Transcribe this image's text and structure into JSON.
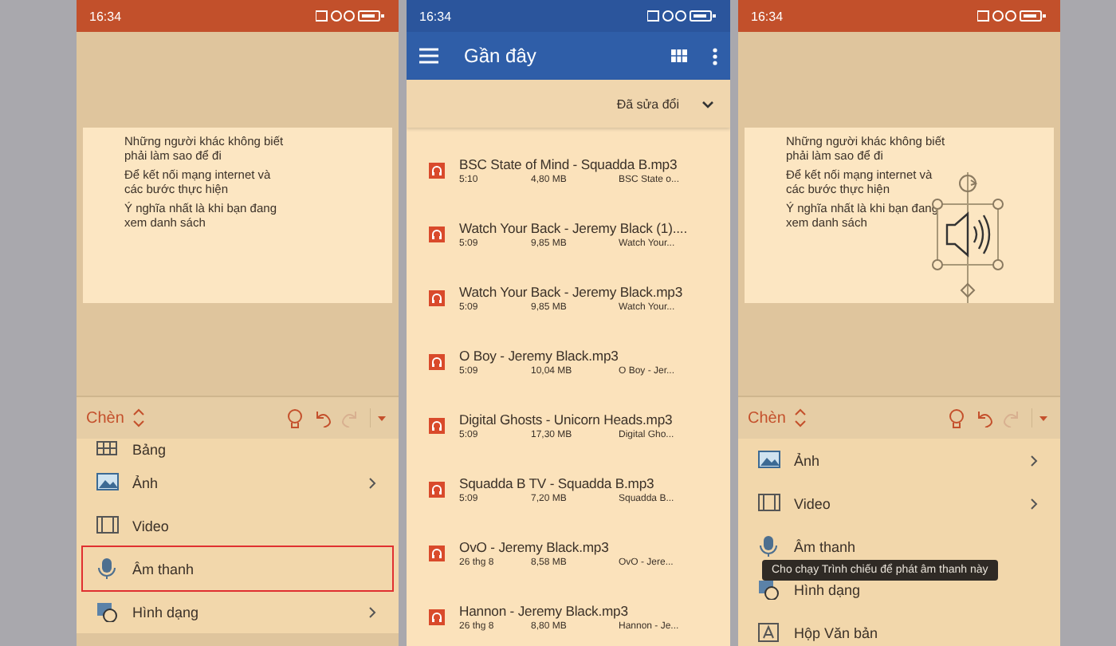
{
  "screens": [
    {
      "kind": "editor",
      "status_bar": {
        "time": "16:34"
      },
      "slide": {
        "lines": [
          "Những người khác không biết phải làm sao để đi",
          "Để kết nối mạng internet và các bước thực hiện",
          "Ý nghĩa nhất là khi bạn đang xem danh sách"
        ],
        "audio_object": false
      },
      "toolbar": {
        "tab": "Chèn",
        "redo_disabled": true
      },
      "menu": [
        {
          "label": "Bảng",
          "kind": "table",
          "submenu": false,
          "selected": false
        },
        {
          "label": "Ảnh",
          "kind": "image",
          "submenu": true,
          "selected": false
        },
        {
          "label": "Video",
          "kind": "film",
          "submenu": false,
          "selected": false
        },
        {
          "label": "Âm thanh",
          "kind": "mic",
          "submenu": false,
          "selected": true
        },
        {
          "label": "Hình dạng",
          "kind": "shape",
          "submenu": true,
          "selected": false
        }
      ]
    },
    {
      "kind": "files",
      "status_bar": {
        "time": "16:34"
      },
      "title": "Gần đây",
      "sort": "Đã sửa đổi",
      "files": [
        {
          "name": "BSC State of Mind - Squadda B.mp3",
          "date": "5:10",
          "size": "4,80 MB",
          "location": "BSC State o..."
        },
        {
          "name": "Watch Your Back - Jeremy Black (1)....",
          "date": "5:09",
          "size": "9,85 MB",
          "location": "Watch Your..."
        },
        {
          "name": "Watch Your Back - Jeremy Black.mp3",
          "date": "5:09",
          "size": "9,85 MB",
          "location": "Watch Your..."
        },
        {
          "name": "O Boy - Jeremy Black.mp3",
          "date": "5:09",
          "size": "10,04 MB",
          "location": "O Boy - Jer..."
        },
        {
          "name": "Digital Ghosts - Unicorn Heads.mp3",
          "date": "5:09",
          "size": "17,30 MB",
          "location": "Digital Gho..."
        },
        {
          "name": "Squadda B TV - Squadda B.mp3",
          "date": "5:09",
          "size": "7,20 MB",
          "location": "Squadda B..."
        },
        {
          "name": "OvO - Jeremy Black.mp3",
          "date": "26 thg 8",
          "size": "8,58 MB",
          "location": "OvO - Jere..."
        },
        {
          "name": "Hannon - Jeremy Black.mp3",
          "date": "26 thg 8",
          "size": "8,80 MB",
          "location": "Hannon - Je..."
        }
      ]
    },
    {
      "kind": "editor",
      "status_bar": {
        "time": "16:34"
      },
      "slide": {
        "lines": [
          "Những người khác không biết phải làm sao để đi",
          "Để kết nối mạng internet và các bước thực hiện",
          "Ý nghĩa nhất là khi bạn đang xem danh sách"
        ],
        "audio_object": true
      },
      "toolbar": {
        "tab": "Chèn",
        "redo_disabled": true
      },
      "menu": [
        {
          "label": "Ảnh",
          "kind": "image",
          "submenu": true,
          "selected": false
        },
        {
          "label": "Video",
          "kind": "film",
          "submenu": true,
          "selected": false
        },
        {
          "label": "Âm thanh",
          "kind": "mic",
          "submenu": false,
          "selected": false
        },
        {
          "label": "Hình dạng",
          "kind": "shape",
          "submenu": false,
          "selected": false
        },
        {
          "label": "Hộp Văn bản",
          "kind": "textbox",
          "submenu": false,
          "selected": false
        }
      ],
      "tooltip": "Cho chạy Trình chiếu để phát âm thanh này"
    }
  ]
}
